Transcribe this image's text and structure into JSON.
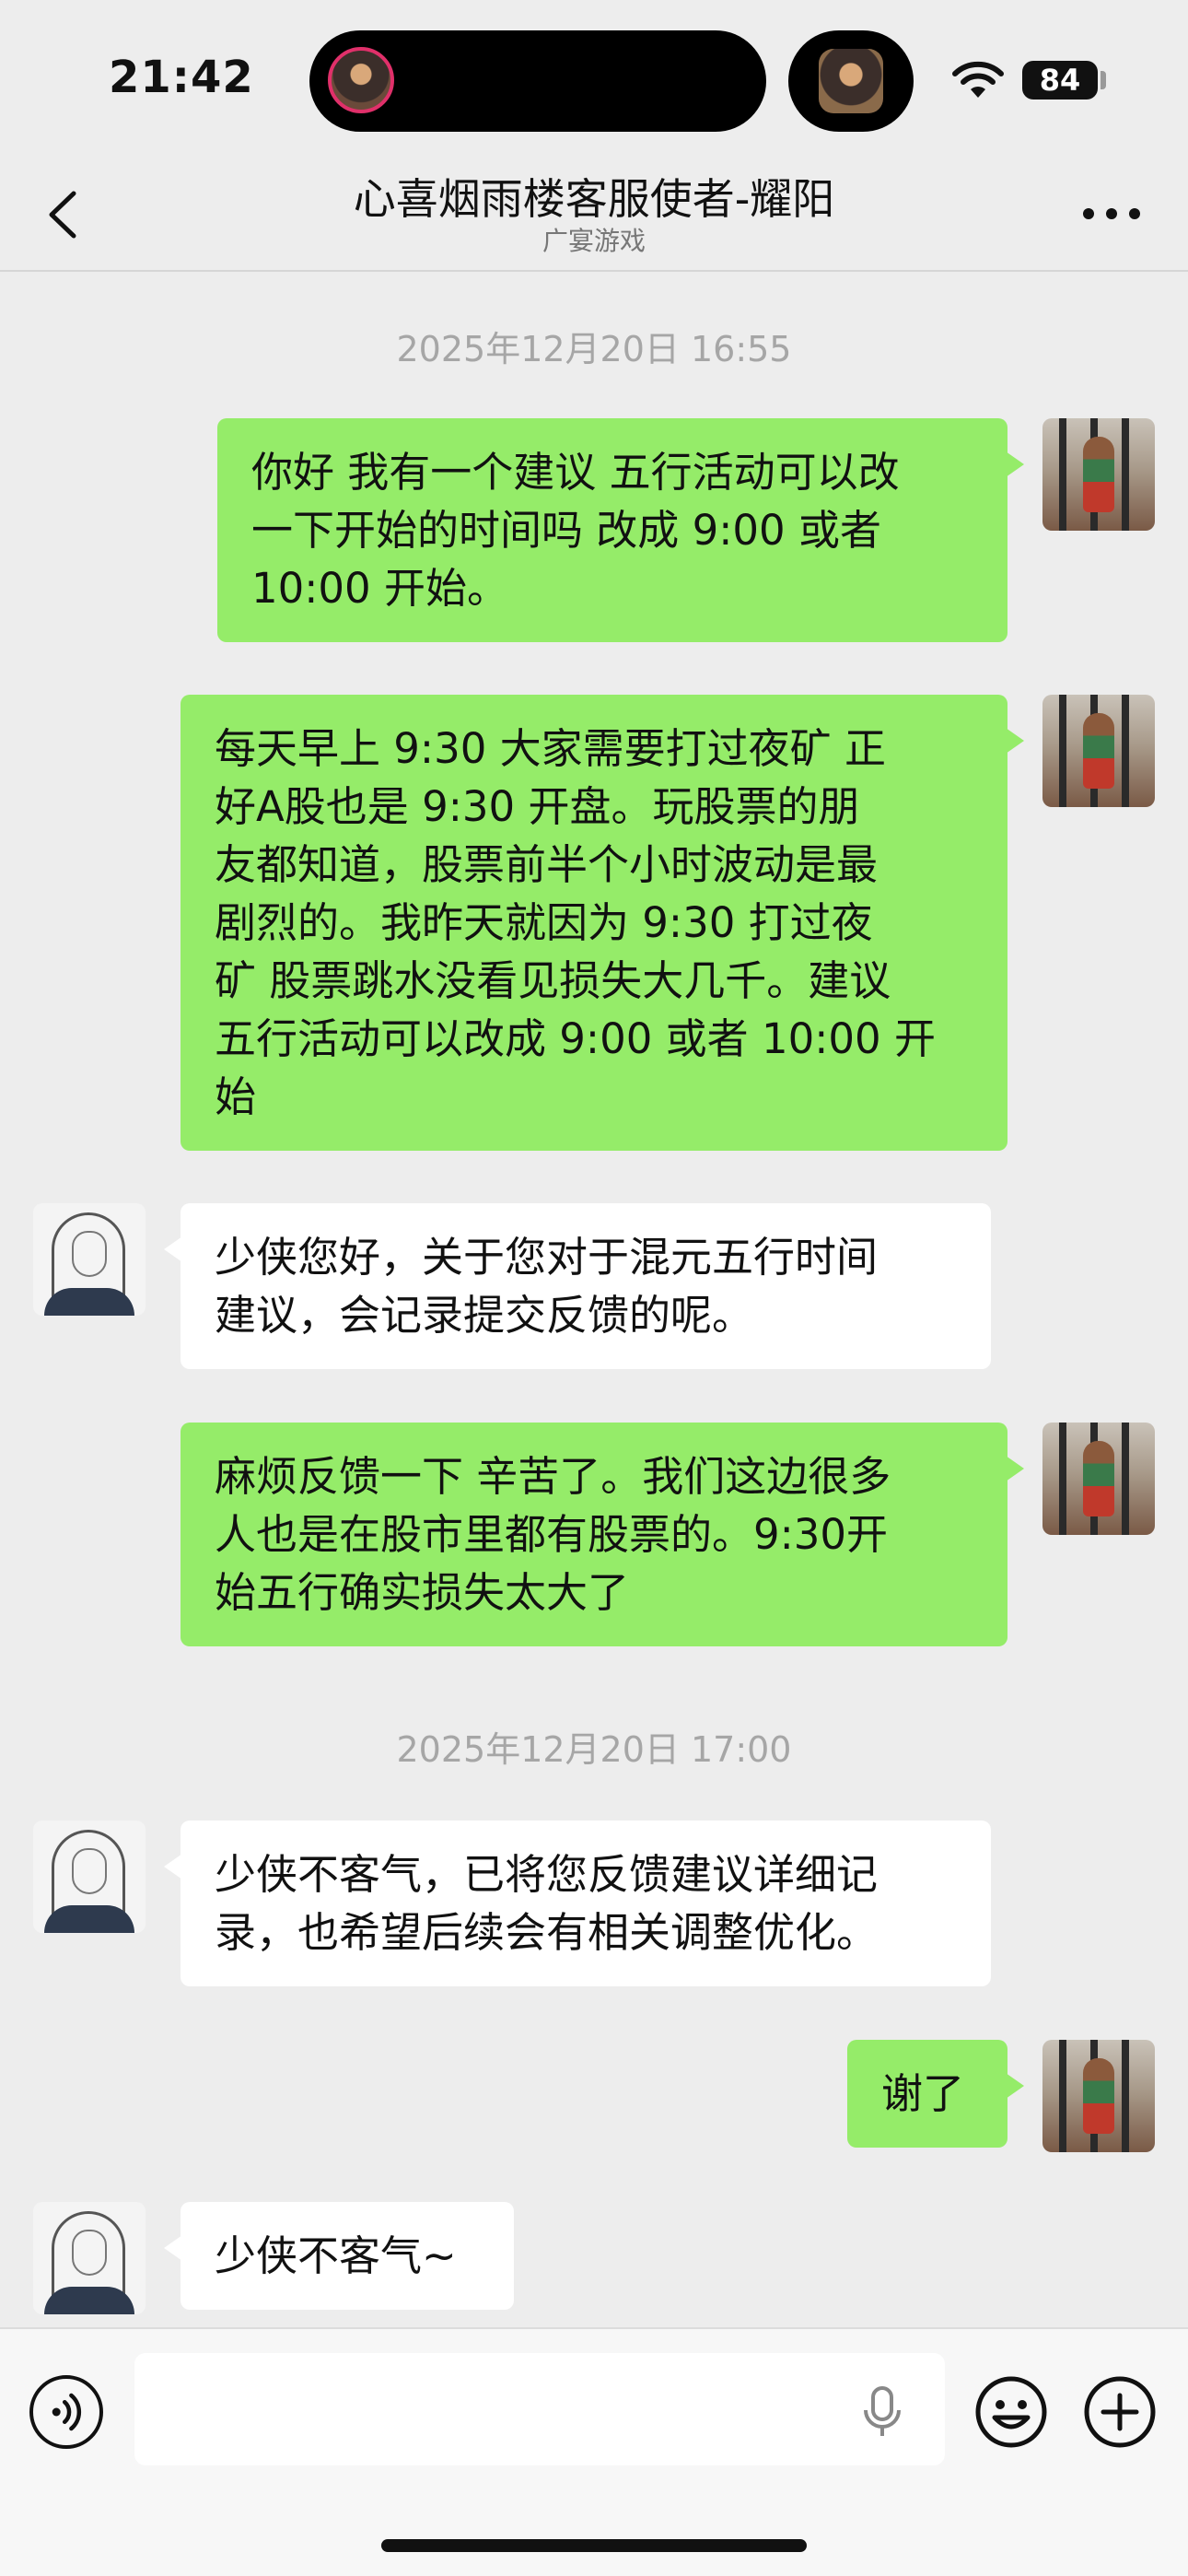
{
  "status_bar": {
    "time": "21:42",
    "battery": "84"
  },
  "header": {
    "title": "心喜烟雨楼客服使者-耀阳",
    "subtitle": "广宴游戏"
  },
  "messages": {
    "ts1": "2025年12月20日 16:55",
    "m1": [
      "你好 我有一个建议 五行活动可以改",
      "一下开始的时间吗 改成 9:00 或者",
      "10:00 开始。"
    ],
    "m2": [
      "每天早上 9:30 大家需要打过夜矿 正",
      "好A股也是 9:30 开盘。玩股票的朋",
      "友都知道，股票前半个小时波动是最",
      "剧烈的。我昨天就因为 9:30 打过夜",
      "矿 股票跳水没看见损失大几千。建议",
      "五行活动可以改成 9:00 或者 10:00 开",
      "始"
    ],
    "m3": [
      "少侠您好，关于您对于混元五行时间",
      "建议，会记录提交反馈的呢。"
    ],
    "m4": [
      "麻烦反馈一下 辛苦了。我们这边很多",
      "人也是在股市里都有股票的。9:30开",
      "始五行确实损失太大了"
    ],
    "ts2": "2025年12月20日 17:00",
    "m5": [
      "少侠不客气，已将您反馈建议详细记",
      "录，也希望后续会有相关调整优化。"
    ],
    "m6": [
      "谢了"
    ],
    "m7": [
      "少侠不客气~"
    ]
  },
  "input": {
    "value": ""
  },
  "colors": {
    "my_bubble": "#95ec69",
    "their_bubble": "#ffffff",
    "background": "#ededed"
  }
}
